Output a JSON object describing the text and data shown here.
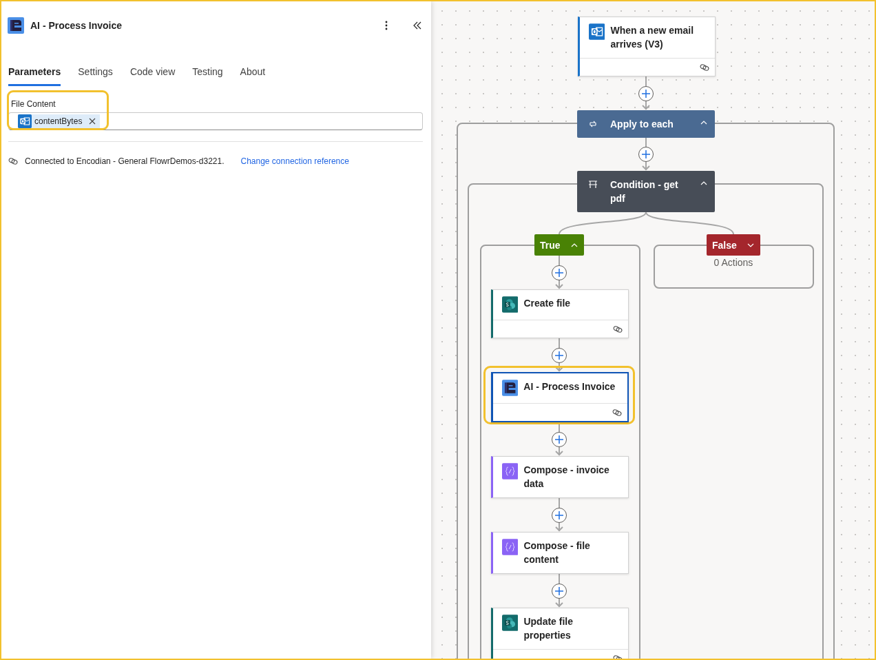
{
  "panel": {
    "title": "AI - Process Invoice",
    "tabs": [
      {
        "label": "Parameters",
        "selected": true
      },
      {
        "label": "Settings",
        "selected": false
      },
      {
        "label": "Code view",
        "selected": false
      },
      {
        "label": "Testing",
        "selected": false
      },
      {
        "label": "About",
        "selected": false
      }
    ],
    "field": {
      "label": "File Content",
      "highlighted": true,
      "token": "contentBytes"
    },
    "connection": {
      "text": "Connected to Encodian - General FlowrDemos-d3221.",
      "link": "Change connection reference"
    }
  },
  "flow": {
    "trigger": {
      "title": "When a new email arrives (V3)",
      "kind": "outlook"
    },
    "loop": {
      "title": "Apply to each",
      "expanded": true
    },
    "condition": {
      "title": "Condition - get pdf",
      "expanded": true
    },
    "branches": [
      {
        "kind": "true",
        "label": "True",
        "expanded": true,
        "actions": [
          {
            "title": "Create file",
            "kind": "sharepoint",
            "selected": false
          },
          {
            "title": "AI - Process Invoice",
            "kind": "encodian",
            "selected": true
          },
          {
            "title": "Compose - invoice data",
            "kind": "compose",
            "selected": false
          },
          {
            "title": "Compose - file content",
            "kind": "compose",
            "selected": false
          },
          {
            "title": "Update file properties",
            "kind": "sharepoint",
            "selected": false
          }
        ]
      },
      {
        "kind": "false",
        "label": "False",
        "expanded": false,
        "empty_text": "0 Actions"
      }
    ]
  }
}
